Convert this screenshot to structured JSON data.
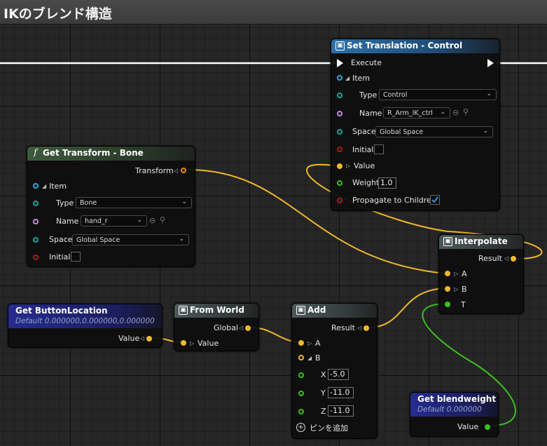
{
  "title": "IKのブレンド構造",
  "colors": {
    "exec": "#ffffff",
    "struct": "#f0b82a",
    "name": "#c58ae0",
    "enum": "#18a6a0",
    "bool": "#a32020",
    "float": "#39c020",
    "item": "#2aa8d8"
  },
  "set_translation": {
    "title": "Set Translation - Control",
    "execute": "Execute",
    "item": "Item",
    "type_label": "Type",
    "type_value": "Control",
    "name_label": "Name",
    "name_value": "R_Arm_IK_ctrl",
    "space_label": "Space",
    "space_value": "Global Space",
    "initial": "Initial",
    "value": "Value",
    "weight_label": "Weight",
    "weight_value": "1.0",
    "propagate": "Propagate to Children",
    "propagate_checked": true
  },
  "get_transform": {
    "title": "Get Transform - Bone",
    "transform": "Transform",
    "item": "Item",
    "type_label": "Type",
    "type_value": "Bone",
    "name_label": "Name",
    "name_value": "hand_r",
    "space_label": "Space",
    "space_value": "Global Space",
    "initial": "Initial"
  },
  "interpolate": {
    "title": "Interpolate",
    "result": "Result",
    "a": "A",
    "b": "B",
    "t": "T"
  },
  "get_button_location": {
    "title": "Get ButtonLocation",
    "default": "Default 0.000000,0.000000,0.000000",
    "value": "Value"
  },
  "from_world": {
    "title": "From World",
    "global": "Global",
    "value": "Value"
  },
  "add": {
    "title": "Add",
    "result": "Result",
    "a": "A",
    "b": "B",
    "x_label": "X",
    "x_value": "-5.0",
    "y_label": "Y",
    "y_value": "-11.0",
    "z_label": "Z",
    "z_value": "-11.0",
    "add_pin": "ピンを追加"
  },
  "get_blendweight": {
    "title": "Get blendweight",
    "default": "Default 0.000000",
    "value": "Value"
  }
}
